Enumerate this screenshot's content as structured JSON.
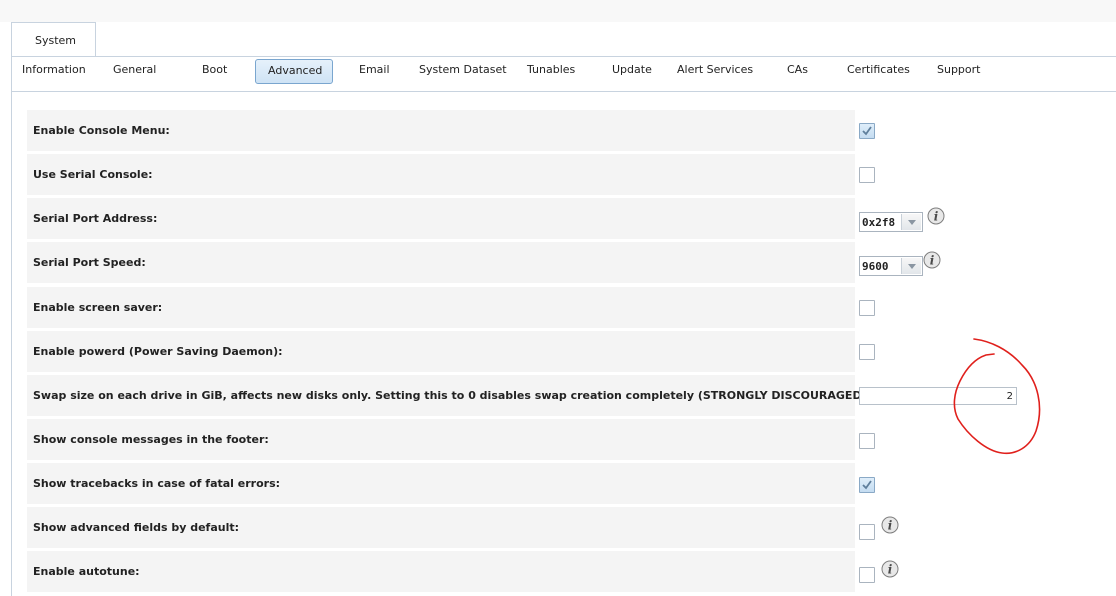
{
  "outer_tab": {
    "label": "System"
  },
  "subtabs": [
    {
      "label": "Information",
      "active": false
    },
    {
      "label": "General",
      "active": false
    },
    {
      "label": "Boot",
      "active": false
    },
    {
      "label": "Advanced",
      "active": true
    },
    {
      "label": "Email",
      "active": false
    },
    {
      "label": "System Dataset",
      "active": false
    },
    {
      "label": "Tunables",
      "active": false
    },
    {
      "label": "Update",
      "active": false
    },
    {
      "label": "Alert Services",
      "active": false
    },
    {
      "label": "CAs",
      "active": false
    },
    {
      "label": "Certificates",
      "active": false
    },
    {
      "label": "Support",
      "active": false
    }
  ],
  "settings": {
    "console_menu": {
      "label": "Enable Console Menu:",
      "checked": true
    },
    "serial_console": {
      "label": "Use Serial Console:",
      "checked": false
    },
    "serial_port_address": {
      "label": "Serial Port Address:",
      "value": "0x2f8",
      "info_icon": "info-icon"
    },
    "serial_port_speed": {
      "label": "Serial Port Speed:",
      "value": "9600",
      "info_icon": "info-icon"
    },
    "screen_saver": {
      "label": "Enable screen saver:",
      "checked": false
    },
    "powerd": {
      "label": "Enable powerd (Power Saving Daemon):",
      "checked": false
    },
    "swap_size": {
      "label": "Swap size on each drive in GiB, affects new disks only. Setting this to 0 disables swap creation completely (STRONGLY DISCOURAGED).",
      "value": "2"
    },
    "console_messages": {
      "label": "Show console messages in the footer:",
      "checked": false
    },
    "tracebacks": {
      "label": "Show tracebacks in case of fatal errors:",
      "checked": true
    },
    "advanced_fields": {
      "label": "Show advanced fields by default:",
      "checked": false,
      "info_icon": "info-icon"
    },
    "autotune": {
      "label": "Enable autotune:",
      "checked": false,
      "info_icon": "info-icon"
    }
  },
  "colors": {
    "annotation": "#e0201c",
    "row_bg": "#f4f4f4",
    "active_tab_border": "#7aa6cf"
  }
}
